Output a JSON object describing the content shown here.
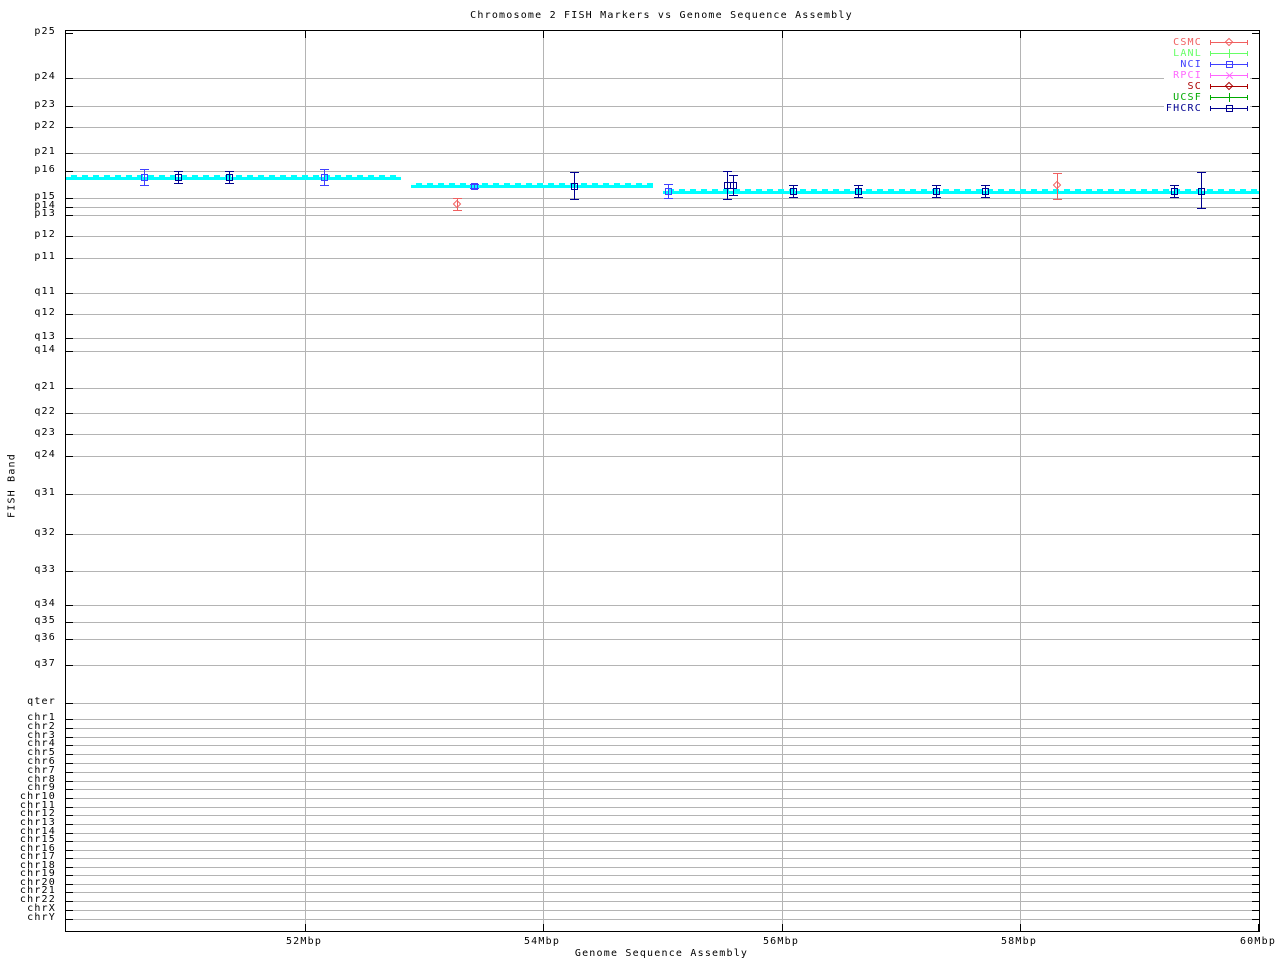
{
  "chart_data": {
    "type": "scatter",
    "title": "Chromosome 2 FISH Markers vs Genome Sequence Assembly",
    "xlabel": "Genome Sequence Assembly",
    "ylabel": "FISH Band",
    "x_range_mbp": [
      50,
      60
    ],
    "x_ticks": [
      {
        "label": "52Mbp",
        "mbp": 52
      },
      {
        "label": "54Mbp",
        "mbp": 54
      },
      {
        "label": "56Mbp",
        "mbp": 56
      },
      {
        "label": "58Mbp",
        "mbp": 58
      },
      {
        "label": "60Mbp",
        "mbp": 60
      }
    ],
    "y_bands": [
      {
        "label": "p25",
        "pos": 2
      },
      {
        "label": "p24",
        "pos": 47
      },
      {
        "label": "p23",
        "pos": 75
      },
      {
        "label": "p22",
        "pos": 96
      },
      {
        "label": "p21",
        "pos": 122
      },
      {
        "label": "p16",
        "pos": 140
      },
      {
        "label": "p15",
        "pos": 167
      },
      {
        "label": "p14",
        "pos": 176
      },
      {
        "label": "p13",
        "pos": 184
      },
      {
        "label": "p12",
        "pos": 205
      },
      {
        "label": "p11",
        "pos": 227
      },
      {
        "label": "q11",
        "pos": 262
      },
      {
        "label": "q12",
        "pos": 283
      },
      {
        "label": "q13",
        "pos": 307
      },
      {
        "label": "q14",
        "pos": 320
      },
      {
        "label": "q21",
        "pos": 357
      },
      {
        "label": "q22",
        "pos": 382
      },
      {
        "label": "q23",
        "pos": 403
      },
      {
        "label": "q24",
        "pos": 425
      },
      {
        "label": "q31",
        "pos": 463
      },
      {
        "label": "q32",
        "pos": 503
      },
      {
        "label": "q33",
        "pos": 540
      },
      {
        "label": "q34",
        "pos": 574
      },
      {
        "label": "q35",
        "pos": 591
      },
      {
        "label": "q36",
        "pos": 608
      },
      {
        "label": "q37",
        "pos": 634
      },
      {
        "label": "qter",
        "pos": 672
      },
      {
        "label": "chr1",
        "pos": 688
      },
      {
        "label": "chr2",
        "pos": 697
      },
      {
        "label": "chr3",
        "pos": 706
      },
      {
        "label": "chr4",
        "pos": 714
      },
      {
        "label": "chr5",
        "pos": 723
      },
      {
        "label": "chr6",
        "pos": 732
      },
      {
        "label": "chr7",
        "pos": 741
      },
      {
        "label": "chr8",
        "pos": 750
      },
      {
        "label": "chr9",
        "pos": 758
      },
      {
        "label": "chr10",
        "pos": 767
      },
      {
        "label": "chr11",
        "pos": 776
      },
      {
        "label": "chr12",
        "pos": 784
      },
      {
        "label": "chr13",
        "pos": 793
      },
      {
        "label": "chr14",
        "pos": 802
      },
      {
        "label": "chr15",
        "pos": 810
      },
      {
        "label": "chr16",
        "pos": 819
      },
      {
        "label": "chr17",
        "pos": 827
      },
      {
        "label": "chr18",
        "pos": 836
      },
      {
        "label": "chr19",
        "pos": 844
      },
      {
        "label": "chr20",
        "pos": 853
      },
      {
        "label": "chr21",
        "pos": 861
      },
      {
        "label": "chr22",
        "pos": 870
      },
      {
        "label": "chrX",
        "pos": 879
      },
      {
        "label": "chrY",
        "pos": 888
      }
    ],
    "band_segments": [
      {
        "start_mbp": 50.0,
        "end_mbp": 52.81,
        "pos": 146
      },
      {
        "start_mbp": 52.89,
        "end_mbp": 54.92,
        "pos": 154
      },
      {
        "start_mbp": 55.0,
        "end_mbp": 60.0,
        "pos": 160
      }
    ],
    "series": [
      {
        "name": "CSMC",
        "color": "#f06060",
        "marker": "diamond",
        "points": [
          {
            "mbp": 53.28,
            "pos": 173,
            "lo": 167,
            "hi": 179
          },
          {
            "mbp": 58.31,
            "pos": 154,
            "lo": 142,
            "hi": 168
          }
        ]
      },
      {
        "name": "LANL",
        "color": "#66ff66",
        "marker": "plus",
        "points": []
      },
      {
        "name": "NCI",
        "color": "#4040ff",
        "marker": "square",
        "points": [
          {
            "mbp": 50.65,
            "pos": 146,
            "lo": 138,
            "hi": 154
          },
          {
            "mbp": 52.16,
            "pos": 146,
            "lo": 138,
            "hi": 154
          },
          {
            "mbp": 53.42,
            "pos": 155,
            "lo": 153,
            "hi": 157
          },
          {
            "mbp": 55.05,
            "pos": 160,
            "lo": 153,
            "hi": 167
          }
        ]
      },
      {
        "name": "RPCI",
        "color": "#ff66ff",
        "marker": "x",
        "points": []
      },
      {
        "name": "SC",
        "color": "#aa0000",
        "marker": "diamond",
        "points": []
      },
      {
        "name": "UCSF",
        "color": "#00aa00",
        "marker": "plus",
        "points": []
      },
      {
        "name": "FHCRC",
        "color": "#000090",
        "marker": "square",
        "points": [
          {
            "mbp": 50.94,
            "pos": 146,
            "lo": 140,
            "hi": 152
          },
          {
            "mbp": 51.37,
            "pos": 146,
            "lo": 140,
            "hi": 152
          },
          {
            "mbp": 54.26,
            "pos": 155,
            "lo": 141,
            "hi": 168
          },
          {
            "mbp": 55.54,
            "pos": 154,
            "lo": 140,
            "hi": 168
          },
          {
            "mbp": 55.59,
            "pos": 154,
            "lo": 144,
            "hi": 164
          },
          {
            "mbp": 56.09,
            "pos": 160,
            "lo": 154,
            "hi": 166
          },
          {
            "mbp": 56.64,
            "pos": 160,
            "lo": 154,
            "hi": 166
          },
          {
            "mbp": 57.29,
            "pos": 160,
            "lo": 154,
            "hi": 166
          },
          {
            "mbp": 57.7,
            "pos": 160,
            "lo": 154,
            "hi": 166
          },
          {
            "mbp": 59.29,
            "pos": 160,
            "lo": 154,
            "hi": 166
          },
          {
            "mbp": 59.51,
            "pos": 160,
            "lo": 141,
            "hi": 177
          }
        ]
      }
    ],
    "colors": {
      "band": "#00ffff",
      "grid": "#b4b4b4",
      "axis": "#000000",
      "background": "#ffffff"
    },
    "legend_position": "top-right"
  }
}
